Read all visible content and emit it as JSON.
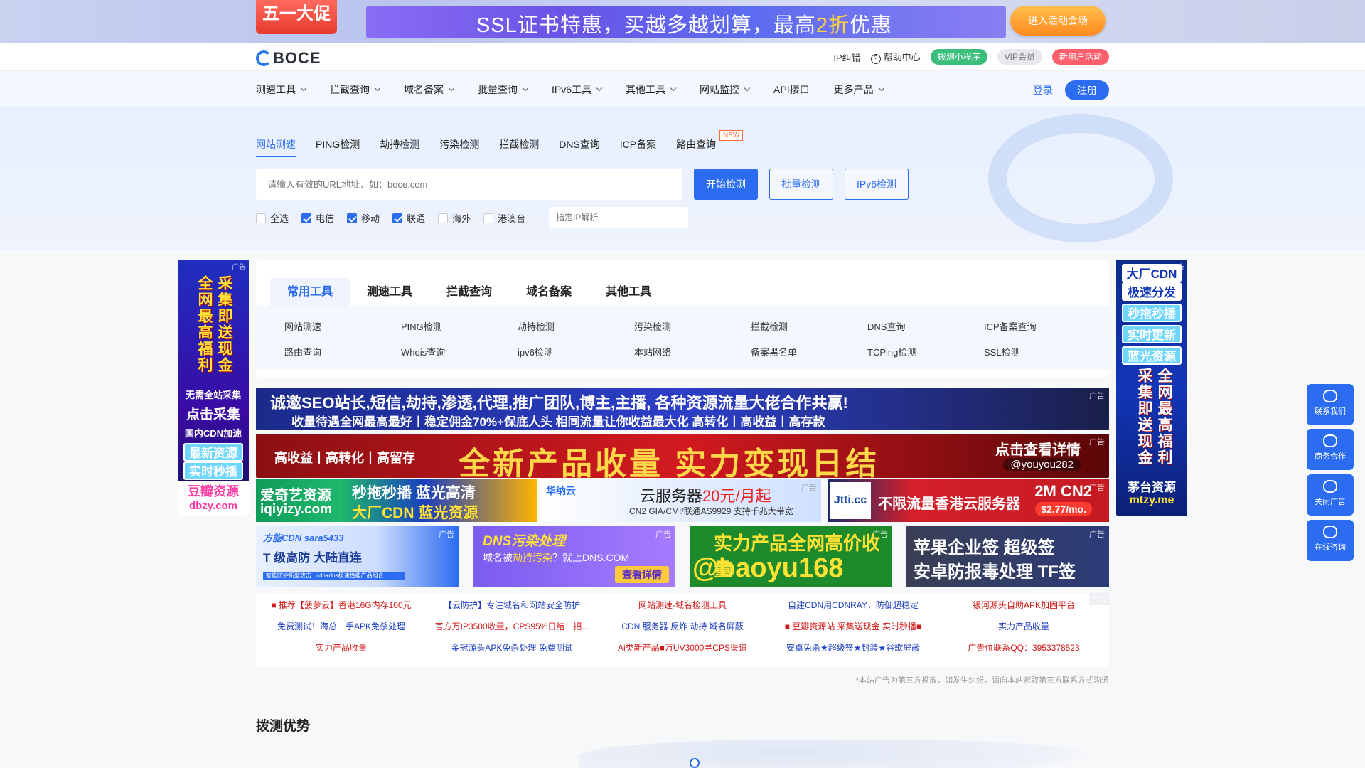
{
  "promo": {
    "badge": "五一大促",
    "text_main": "SSL证书特惠，买越多越划算，最高",
    "text_hl": "2折",
    "text_end": "优惠",
    "button": "进入活动会场"
  },
  "header": {
    "logo": "BOCE",
    "links": [
      "IP纠错",
      "帮助中心"
    ],
    "pills": [
      "拨测小程序",
      "VIP会员",
      "新用户活动"
    ]
  },
  "nav": {
    "items": [
      "测速工具",
      "拦截查询",
      "域名备案",
      "批量查询",
      "IPv6工具",
      "其他工具",
      "网站监控",
      "API接口",
      "更多产品"
    ],
    "login": "登录",
    "register": "注册"
  },
  "search": {
    "tabs": [
      "网站测速",
      "PING检测",
      "劫持检测",
      "污染检测",
      "拦截检测",
      "DNS查询",
      "ICP备案",
      "路由查询"
    ],
    "new_badge": "NEW",
    "placeholder": "请输入有效的URL地址，如：boce.com",
    "start_button": "开始检测",
    "batch_button": "批量检测",
    "ipv6_button": "IPv6检测",
    "checks": [
      {
        "label": "全选",
        "checked": false
      },
      {
        "label": "电信",
        "checked": true
      },
      {
        "label": "移动",
        "checked": true
      },
      {
        "label": "联通",
        "checked": true
      },
      {
        "label": "海外",
        "checked": false
      },
      {
        "label": "港澳台",
        "checked": false
      }
    ],
    "ip_placeholder": "指定IP解析"
  },
  "tools": {
    "tabs": [
      "常用工具",
      "测速工具",
      "拦截查询",
      "域名备案",
      "其他工具"
    ],
    "row1": [
      "网站测速",
      "PING检测",
      "劫持检测",
      "污染检测",
      "拦截检测",
      "DNS查询",
      "ICP备案查询"
    ],
    "row2": [
      "路由查询",
      "Whois查询",
      "ipv6检测",
      "本站网络",
      "备案黑名单",
      "TCPing检测",
      "SSL检测"
    ]
  },
  "ads": {
    "tag": "广告",
    "left": {
      "col1": "采集即送现金",
      "col2": "全网最高福利",
      "l1": "无需全站采集",
      "l2": "点击采集",
      "l3": "国内CDN加速",
      "chip1": "最新资源",
      "chip2": "实时秒播",
      "bottom1": "豆瓣资源",
      "bottom2": "dbzy.com"
    },
    "right": {
      "chip1": "大厂CDN",
      "chip2": "极速分发",
      "chip3": "秒拖秒播",
      "chip4": "实时更新",
      "chip5": "蓝光资源",
      "col1": "全网最高福利",
      "col2": "采集即送现金",
      "l1": "茅台资源",
      "l2": "mtzy.me"
    },
    "b1_t1": "诚邀SEO站长,短信,劫持,渗透,代理,推广团队,博主,主播, 各种资源流量大佬合作共赢!",
    "b1_t2": "收量待遇全网最高最好丨稳定佣金70%+保底人头     相同流量让你收益最大化 高转化丨高收益丨高存款",
    "b2_t1": "高收益丨高转化丨高留存",
    "b2_t2": "全新产品收量  实力变现日结",
    "b2_t3": "点击查看详情",
    "b2_t4": "@youyou282",
    "r3a": {
      "a": "爱奇艺资源",
      "b": "iqiyizy.com",
      "c": "秒拖秒播  蓝光高清",
      "d": "大厂CDN  蓝光资源"
    },
    "r3b": {
      "logo": "华纳云",
      "a": "云服务器",
      "price": "20元/月起",
      "b": "CN2 GIA/CMI/联通AS9929 支持千兆大带宽"
    },
    "r3c": {
      "logo": "Jtti.cc",
      "a": "不限流量香港云服务器",
      "b": "2M CN2",
      "c": "$2.77/mo."
    },
    "r4a": {
      "a": "方能CDN   sara5433",
      "b": "T 级高防 大陆直连",
      "c": "智能防护新型攻击 · cdn+dns极速性能产品组合"
    },
    "r4b": {
      "a": "DNS污染处理",
      "b1": "域名被",
      "b2": "劫持污染",
      "b3": "？就上DNS.COM",
      "c": "查看详情"
    },
    "r4c": {
      "a": "实力产品全网高价收量",
      "b": "@baoyu168"
    },
    "r4d": {
      "a": "苹果企业签  超级签",
      "b": "安卓防报毒处理  TF签"
    }
  },
  "text_ads": [
    {
      "t": "■ 推荐【菠萝云】香港16G内存100元",
      "c": "red"
    },
    {
      "t": "【云防护】专注域名和网站安全防护",
      "c": "blue"
    },
    {
      "t": "网站测速-域名检测工具",
      "c": "red"
    },
    {
      "t": "自建CDN用CDNRAY，防御超稳定",
      "c": "blue"
    },
    {
      "t": "银河源头自助APK加固平台",
      "c": "red"
    },
    {
      "t": "免费测试！海总一手APK免杀处理",
      "c": "blue"
    },
    {
      "t": "官方万IP3500收量，CPS95%日结！招...",
      "c": "red"
    },
    {
      "t": "CDN 服务器 反炸 劫持 域名屏蔽",
      "c": "blue"
    },
    {
      "t": "■ 豆瓣资源站 采集送现金 实时秒播■",
      "c": "red"
    },
    {
      "t": "实力产品收量",
      "c": "blue"
    },
    {
      "t": "实力产品收量",
      "c": "red"
    },
    {
      "t": "金冠源头APK免杀处理 免费测试",
      "c": "blue"
    },
    {
      "t": "Ai类新产品■万UV3000寻CPS渠道",
      "c": "red"
    },
    {
      "t": "安卓免杀★超级签★封装★谷歌屏蔽",
      "c": "blue"
    },
    {
      "t": "广告位联系QQ：3953378523",
      "c": "red"
    }
  ],
  "disclaimer": "*本站广告为第三方投放，如发生纠纷，请向本站索取第三方联系方式沟通",
  "section_title": "拨测优势",
  "float": [
    "联系我们",
    "商务合作",
    "关闭广告",
    "在线咨询"
  ]
}
